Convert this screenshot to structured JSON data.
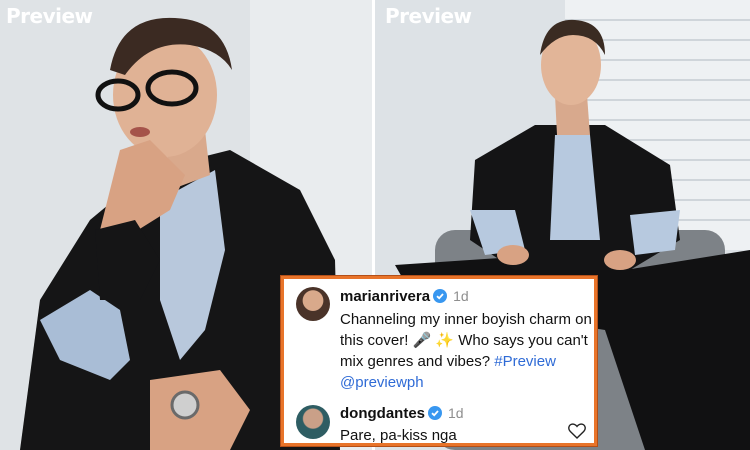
{
  "brand": {
    "left_logo": "Preview",
    "right_logo": "Preview"
  },
  "comments": [
    {
      "username": "marianrivera",
      "time": "1d",
      "text_line1": "Channeling my inner boyish charm on",
      "text_line2_part1": "this cover! ",
      "emoji": "🎤 ✨",
      "text_line2_part2": " Who says you can't",
      "text_line3": "mix genres and vibes? ",
      "hashtag": "#Preview",
      "mention": "@previewph"
    },
    {
      "username": "dongdantes",
      "time": "1d",
      "text": "Pare, pa-kiss nga"
    }
  ],
  "colors": {
    "frame": "#e8742a",
    "verified": "#3897f0",
    "link": "#2f6bd6"
  }
}
